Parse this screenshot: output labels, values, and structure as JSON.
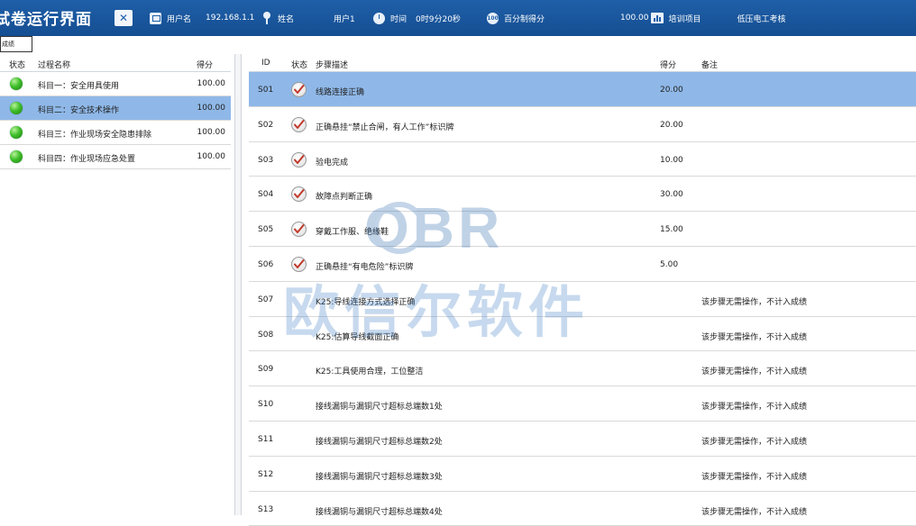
{
  "header": {
    "title": "试卷运行界面",
    "username_label": "用户名",
    "username_value": "192.168.1.1",
    "name_label": "姓名",
    "name_value": "用户1",
    "time_label": "时间",
    "time_value": "0时9分20秒",
    "score_label": "百分制得分",
    "score_value": "100.00",
    "project_label": "培训项目",
    "project_value": "低压电工考核",
    "icons": [
      "xls-icon",
      "ip-icon",
      "person-icon",
      "clock-icon",
      "percent-icon",
      "bar-chart-icon"
    ]
  },
  "tab": {
    "label": "成绩"
  },
  "left_table": {
    "columns": [
      "状态",
      "过程名称",
      "得分"
    ],
    "rows": [
      {
        "name": "科目一：安全用具使用",
        "score": "100.00",
        "selected": false
      },
      {
        "name": "科目二：安全技术操作",
        "score": "100.00",
        "selected": true
      },
      {
        "name": "科目三：作业现场安全隐患排除",
        "score": "100.00",
        "selected": false
      },
      {
        "name": "科目四：作业现场应急处置",
        "score": "100.00",
        "selected": false
      }
    ]
  },
  "right_table": {
    "columns": [
      "ID",
      "状态",
      "步骤描述",
      "得分",
      "备注"
    ],
    "rows": [
      {
        "id": "S01",
        "checked": true,
        "step": "线路连接正确",
        "score": "20.00",
        "note": "",
        "selected": true
      },
      {
        "id": "S02",
        "checked": true,
        "step": "正确悬挂“禁止合闸，有人工作”标识牌",
        "score": "20.00",
        "note": "",
        "selected": false
      },
      {
        "id": "S03",
        "checked": true,
        "step": "验电完成",
        "score": "10.00",
        "note": "",
        "selected": false
      },
      {
        "id": "S04",
        "checked": true,
        "step": "故障点判断正确",
        "score": "30.00",
        "note": "",
        "selected": false
      },
      {
        "id": "S05",
        "checked": true,
        "step": "穿戴工作服、绝缘鞋",
        "score": "15.00",
        "note": "",
        "selected": false
      },
      {
        "id": "S06",
        "checked": true,
        "step": "正确悬挂“有电危险”标识牌",
        "score": "5.00",
        "note": "",
        "selected": false
      },
      {
        "id": "S07",
        "checked": false,
        "step": "K25:导线连接方式选择正确",
        "score": "",
        "note": "该步骤无需操作，不计入成绩",
        "selected": false
      },
      {
        "id": "S08",
        "checked": false,
        "step": "K25:估算导线截面正确",
        "score": "",
        "note": "该步骤无需操作，不计入成绩",
        "selected": false
      },
      {
        "id": "S09",
        "checked": false,
        "step": "K25:工具使用合理，工位整洁",
        "score": "",
        "note": "该步骤无需操作，不计入成绩",
        "selected": false
      },
      {
        "id": "S10",
        "checked": false,
        "step": "接线漏铜与漏铜尺寸超标总端数1处",
        "score": "",
        "note": "该步骤无需操作，不计入成绩",
        "selected": false
      },
      {
        "id": "S11",
        "checked": false,
        "step": "接线漏铜与漏铜尺寸超标总端数2处",
        "score": "",
        "note": "该步骤无需操作，不计入成绩",
        "selected": false
      },
      {
        "id": "S12",
        "checked": false,
        "step": "接线漏铜与漏铜尺寸超标总端数3处",
        "score": "",
        "note": "该步骤无需操作，不计入成绩",
        "selected": false
      },
      {
        "id": "S13",
        "checked": false,
        "step": "接线漏铜与漏铜尺寸超标总端数4处",
        "score": "",
        "note": "该步骤无需操作，不计入成绩",
        "selected": false
      }
    ]
  },
  "watermark": {
    "logo": "OBR",
    "text": "欧信尔软件"
  },
  "colors": {
    "header_bg": "#1a57a0",
    "selected_row": "#8fb8e8",
    "status_ok": "#3fbf2a"
  }
}
